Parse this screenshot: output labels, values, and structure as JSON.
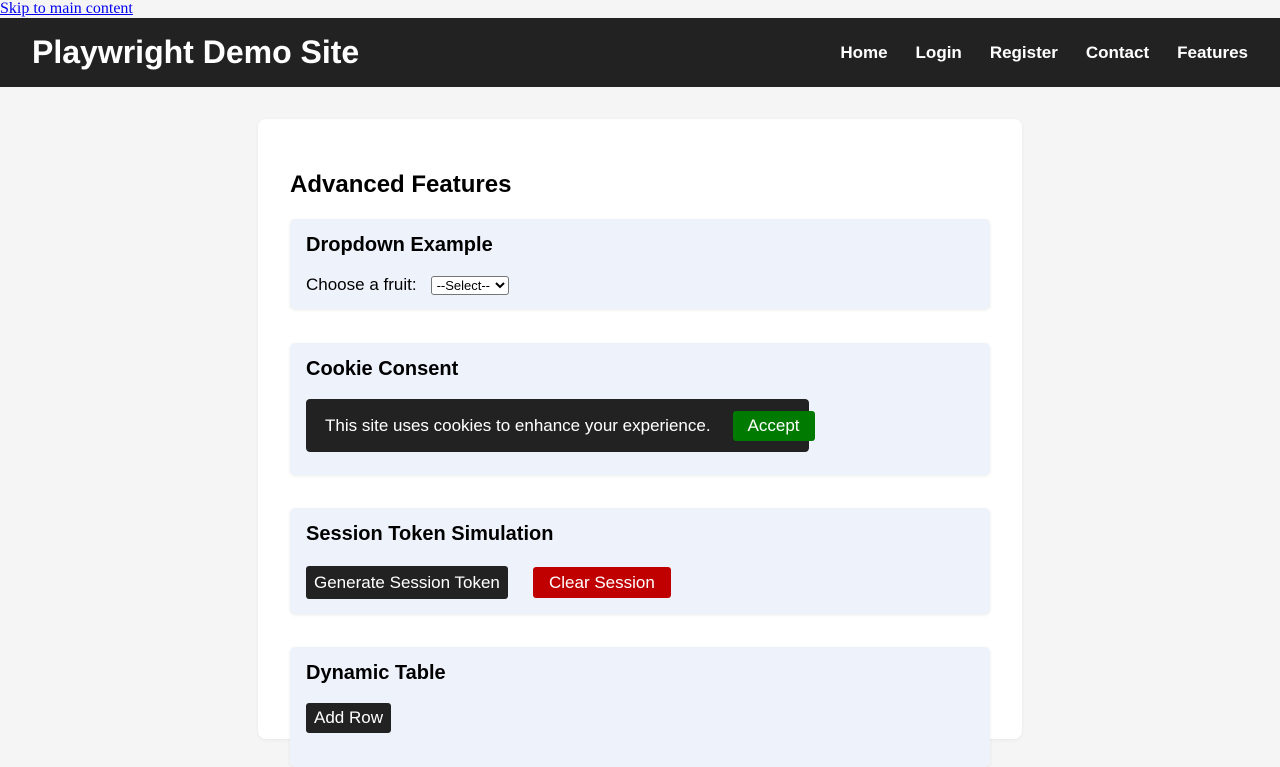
{
  "skip_link": "Skip to main content",
  "header": {
    "site_title": "Playwright Demo Site",
    "nav": [
      "Home",
      "Login",
      "Register",
      "Contact",
      "Features"
    ]
  },
  "main": {
    "title": "Advanced Features",
    "dropdown": {
      "heading": "Dropdown Example",
      "label": "Choose a fruit:",
      "selected": "--Select--"
    },
    "cookie": {
      "heading": "Cookie Consent",
      "message": "This site uses cookies to enhance your experience.",
      "accept_label": "Accept"
    },
    "session": {
      "heading": "Session Token Simulation",
      "generate_label": "Generate Session Token",
      "clear_label": "Clear Session"
    },
    "table": {
      "heading": "Dynamic Table",
      "add_row_label": "Add Row"
    }
  },
  "colors": {
    "header_bg": "#222222",
    "section_bg": "#eef2fa",
    "accept_green": "#007a00",
    "clear_red": "#c00000"
  }
}
